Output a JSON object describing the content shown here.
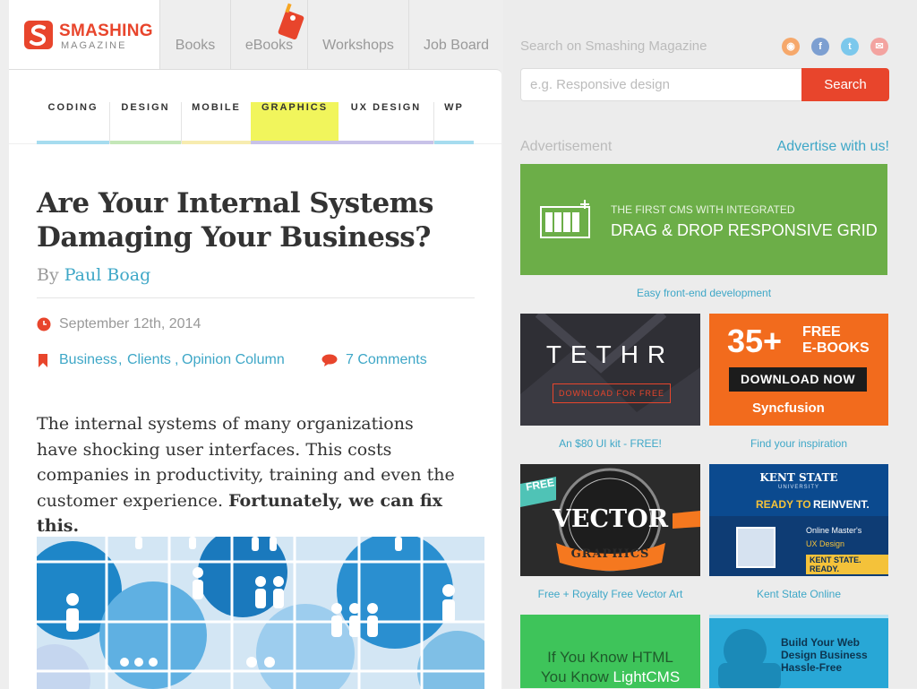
{
  "logo": {
    "name": "SMASHING",
    "sub": "MAGAZINE"
  },
  "nav": [
    "Books",
    "eBooks",
    "Workshops",
    "Job Board"
  ],
  "categories": [
    {
      "label": "CODING",
      "color": "#a6dcef"
    },
    {
      "label": "DESIGN",
      "color": "#c4e7b8"
    },
    {
      "label": "MOBILE",
      "color": "#f7ecb0"
    },
    {
      "label": "GRAPHICS",
      "color": "#f1f55c"
    },
    {
      "label": "UX DESIGN",
      "color": "#c8c2e8"
    },
    {
      "label": "WP",
      "color": "#a6dcef"
    }
  ],
  "article": {
    "title": "Are Your Internal Systems Damaging Your Business?",
    "by": "By",
    "author": "Paul Boag",
    "date": "September 12th, 2014",
    "tags": [
      "Business",
      "Clients",
      "Opinion Column"
    ],
    "comments": "7 Comments",
    "intro": "The internal systems of many organizations have shocking user interfaces. This costs companies in productivity, training and even the customer experience.",
    "intro_bold": "Fortunately, we can fix this."
  },
  "search": {
    "label": "Search on Smashing Magazine",
    "placeholder": "e.g. Responsive design",
    "button": "Search"
  },
  "social": [
    "rss-icon",
    "facebook-icon",
    "twitter-icon",
    "email-icon"
  ],
  "ads": {
    "label": "Advertisement",
    "advertise_link": "Advertise with us!",
    "banner": {
      "line1": "THE FIRST CMS WITH INTEGRATED",
      "line2": "DRAG & DROP RESPONSIVE GRID",
      "caption": "Easy front-end development"
    },
    "tethr": {
      "logo": "TETHR",
      "button": "DOWNLOAD FOR FREE",
      "caption": "An $80 UI kit - FREE!"
    },
    "syncfusion": {
      "big": "35+",
      "free": "FREE",
      "ebooks": "E-BOOKS",
      "button": "DOWNLOAD NOW",
      "brand": "Syncfusion",
      "caption": "Find your inspiration"
    },
    "vector": {
      "free": "FREE",
      "word": "VECTOR",
      "ribbon": "GRAPHICS",
      "caption": "Free + Royalty Free Vector Art"
    },
    "kent": {
      "brand": "KENT STATE",
      "sub": "UNIVERSITY",
      "ready": "READY TO",
      "reinvent": "REINVENT.",
      "prog1": "Online Master's",
      "prog2": "UX Design",
      "tag": "KENT STATE. READY.",
      "caption": "Kent State Online"
    },
    "lightcms": {
      "line1": "If You Know HTML",
      "line2a": "You Know ",
      "line2b": "LightCMS"
    },
    "business": {
      "line1": "Build Your Web",
      "line2": "Design Business",
      "line3": "Hassle-Free"
    }
  },
  "colors": {
    "brand": "#e8452c",
    "link": "#3ea7c7",
    "banner_green": "#6cae48",
    "ad_orange": "#f26b1d",
    "kent_blue": "#0b4a8f",
    "green_ad": "#3ec45a",
    "blue_ad": "#28a7d6"
  }
}
